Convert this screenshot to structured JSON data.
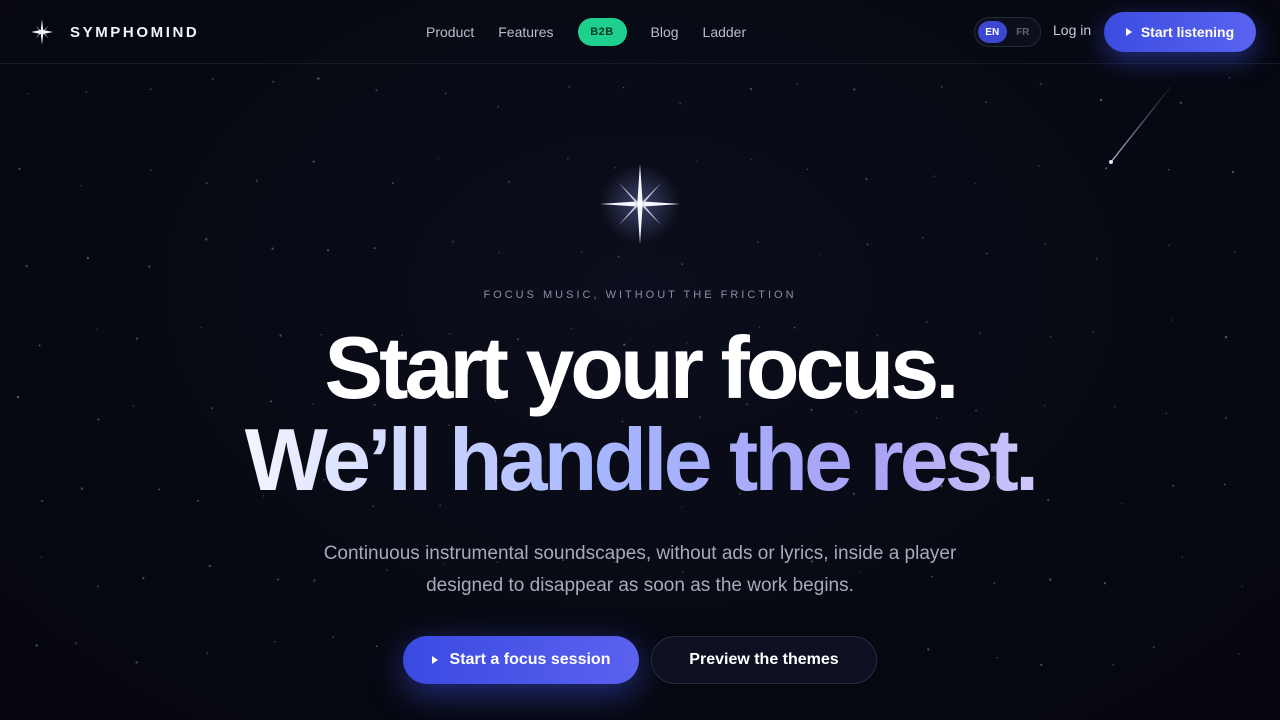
{
  "brand": {
    "name": "SYMPHOMIND",
    "icon": "sparkle-star-icon"
  },
  "nav": {
    "items": [
      {
        "label": "Product"
      },
      {
        "label": "Features"
      },
      {
        "label": "B2B",
        "badge": true,
        "color": "#1fcf8d"
      },
      {
        "label": "Blog"
      },
      {
        "label": "Ladder"
      }
    ]
  },
  "language": {
    "options": [
      "EN",
      "FR"
    ],
    "selected": "EN"
  },
  "header_actions": {
    "login_label": "Log in",
    "cta_label": "Start listening",
    "cta_icon": "play-icon"
  },
  "hero": {
    "eyebrow": "FOCUS MUSIC, WITHOUT THE FRICTION",
    "headline_line1": "Start your focus.",
    "headline_line2": "We’ll handle the rest.",
    "subtitle": "Continuous instrumental soundscapes, without ads or lyrics, inside a player designed to disappear as soon as the work begins.",
    "primary_cta": "Start a focus session",
    "secondary_cta": "Preview the themes",
    "icon": "compass-star-icon"
  },
  "colors": {
    "background": "#070912",
    "accent": "#4a56e8",
    "badge": "#1fcf8d",
    "gradient_text": [
      "#f3f5ff",
      "#a6b6ff",
      "#a9a3f5"
    ]
  }
}
